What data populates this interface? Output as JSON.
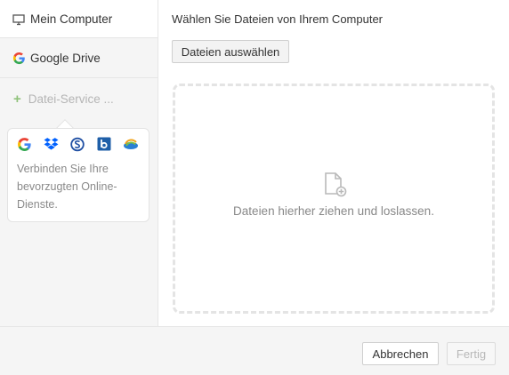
{
  "sidebar": {
    "items": [
      {
        "label": "Mein Computer",
        "icon": "monitor-icon"
      },
      {
        "label": "Google Drive",
        "icon": "google-g-icon"
      },
      {
        "label": "Datei-Service ...",
        "icon": "plus-icon"
      }
    ],
    "popover": {
      "services": [
        "google-icon",
        "dropbox-icon",
        "sharefile-icon",
        "box-icon",
        "onedrive-icon"
      ],
      "text": "Verbinden Sie Ihre bevorzugten Online-Dienste."
    }
  },
  "main": {
    "title": "Wählen Sie Dateien von Ihrem Computer",
    "select_button": "Dateien auswählen",
    "dropzone_text": "Dateien hierher ziehen und loslassen.",
    "dropzone_icon": "file-add-icon"
  },
  "footer": {
    "cancel_label": "Abbrechen",
    "done_label": "Fertig"
  },
  "colors": {
    "sidebar_bg": "#f5f5f5",
    "accent_plus": "#8fc27a",
    "dropzone_border": "#e4e4e4"
  }
}
